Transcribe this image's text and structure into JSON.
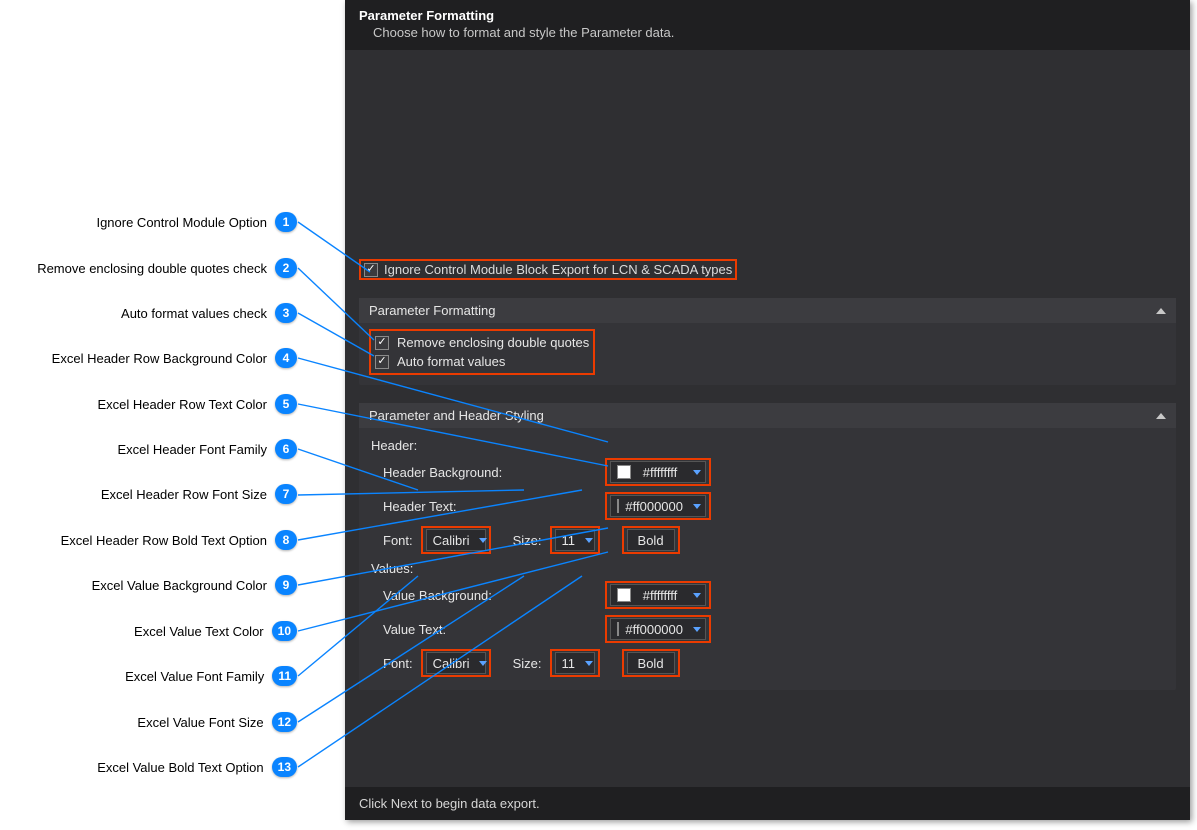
{
  "header": {
    "title": "Parameter Formatting",
    "subtitle": "Choose how to format and style the Parameter data."
  },
  "ignore_option": {
    "label": "Ignore Control Module Block Export for LCN & SCADA types",
    "checked": true
  },
  "section_formatting": {
    "title": "Parameter Formatting",
    "remove_quotes": {
      "label": "Remove enclosing double quotes",
      "checked": true
    },
    "auto_format": {
      "label": "Auto format values",
      "checked": true
    }
  },
  "section_styling": {
    "title": "Parameter and Header Styling",
    "header_group_label": "Header:",
    "values_group_label": "Values:",
    "labels": {
      "header_bg": "Header Background:",
      "header_text": "Header Text:",
      "value_bg": "Value Background:",
      "value_text": "Value Text:",
      "font": "Font:",
      "size": "Size:",
      "bold": "Bold"
    },
    "header": {
      "bg_value": "#ffffffff",
      "text_value": "#ff000000",
      "font": "Calibri",
      "size": "11"
    },
    "values": {
      "bg_value": "#ffffffff",
      "text_value": "#ff000000",
      "font": "Calibri",
      "size": "11"
    }
  },
  "footer": "Click Next to begin data export.",
  "annotations": [
    {
      "n": "1",
      "label": "Ignore Control Module Option"
    },
    {
      "n": "2",
      "label": "Remove enclosing double quotes check"
    },
    {
      "n": "3",
      "label": "Auto format values check"
    },
    {
      "n": "4",
      "label": "Excel Header Row Background Color"
    },
    {
      "n": "5",
      "label": "Excel Header Row Text Color"
    },
    {
      "n": "6",
      "label": "Excel Header Font Family"
    },
    {
      "n": "7",
      "label": "Excel Header Row Font Size"
    },
    {
      "n": "8",
      "label": "Excel Header Row Bold Text Option"
    },
    {
      "n": "9",
      "label": "Excel Value Background Color"
    },
    {
      "n": "10",
      "label": "Excel Value Text Color"
    },
    {
      "n": "11",
      "label": "Excel Value Font Family"
    },
    {
      "n": "12",
      "label": "Excel Value Font Size"
    },
    {
      "n": "13",
      "label": "Excel Value Bold Text Option"
    }
  ]
}
